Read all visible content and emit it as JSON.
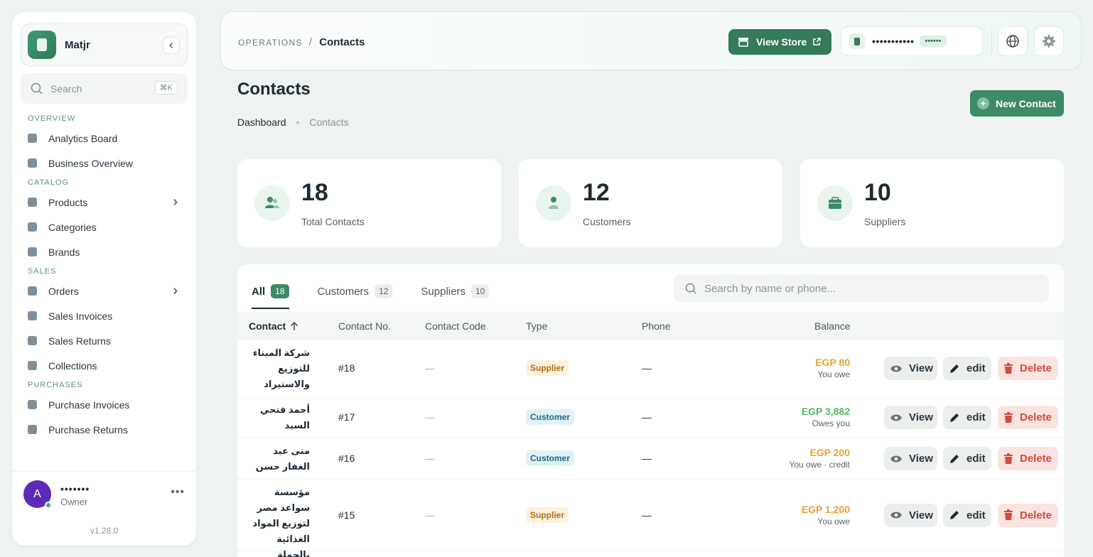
{
  "app": {
    "name": "Matjr",
    "version": "v1.28.0"
  },
  "sidebar": {
    "search": {
      "placeholder": "Search",
      "shortcut": "⌘K"
    },
    "sections": [
      {
        "title": "OVERVIEW",
        "items": [
          {
            "label": "Analytics Board",
            "icon": "chart-icon"
          },
          {
            "label": "Business Overview",
            "icon": "grid-icon"
          }
        ]
      },
      {
        "title": "CATALOG",
        "items": [
          {
            "label": "Products",
            "icon": "box-icon",
            "chevron": true
          },
          {
            "label": "Categories",
            "icon": "shapes-icon"
          },
          {
            "label": "Brands",
            "icon": "tag-icon"
          }
        ]
      },
      {
        "title": "SALES",
        "items": [
          {
            "label": "Orders",
            "icon": "cart-icon",
            "chevron": true
          },
          {
            "label": "Sales Invoices",
            "icon": "invoice-icon"
          },
          {
            "label": "Sales Returns",
            "icon": "return-icon"
          },
          {
            "label": "Collections",
            "icon": "coins-icon"
          }
        ]
      },
      {
        "title": "PURCHASES",
        "items": [
          {
            "label": "Purchase Invoices",
            "icon": "invoice-icon"
          },
          {
            "label": "Purchase Returns",
            "icon": "return-icon"
          }
        ]
      }
    ],
    "user": {
      "initial": "A",
      "name": "•••••••",
      "role": "Owner"
    }
  },
  "topbar": {
    "breadcrumb_parent": "OPERATIONS",
    "breadcrumb_sep": "/",
    "breadcrumb_current": "Contacts",
    "view_store_label": "View Store",
    "store_name": "•••••••••••",
    "store_badge": "••••••"
  },
  "page": {
    "title": "Contacts",
    "breadcrumb": [
      "Dashboard",
      "Contacts"
    ],
    "new_button": "New Contact"
  },
  "stats": [
    {
      "value": "18",
      "label": "Total Contacts",
      "icon": "users-icon"
    },
    {
      "value": "12",
      "label": "Customers",
      "icon": "user-icon"
    },
    {
      "value": "10",
      "label": "Suppliers",
      "icon": "briefcase-icon"
    }
  ],
  "tabs": [
    {
      "label": "All",
      "count": "18",
      "active": true
    },
    {
      "label": "Customers",
      "count": "12"
    },
    {
      "label": "Suppliers",
      "count": "10"
    }
  ],
  "table_search": {
    "placeholder": "Search by name or phone..."
  },
  "columns": [
    "Contact",
    "Contact No.",
    "Contact Code",
    "Type",
    "Phone",
    "Balance"
  ],
  "actions": {
    "view": "View",
    "edit": "edit",
    "delete": "Delete"
  },
  "rows": [
    {
      "name": "شركة الميناء للتوزيع والاستيراد",
      "no": "#18",
      "code": "—",
      "type": "Supplier",
      "phone": "—",
      "amount": "EGP 80",
      "note": "You owe",
      "color": "#e8a134"
    },
    {
      "name": "أحمد فتحي السيد",
      "no": "#17",
      "code": "—",
      "type": "Customer",
      "phone": "—",
      "amount": "EGP 3,882",
      "note": "Owes you",
      "color": "#4db85d"
    },
    {
      "name": "منى عبد الغفار حسن",
      "no": "#16",
      "code": "—",
      "type": "Customer",
      "phone": "—",
      "amount": "EGP 200",
      "note": "You owe · credit",
      "color": "#e8a134"
    },
    {
      "name": "مؤسسة سواعد مصر لتوزيع المواد الغذائية بالجملة",
      "no": "#15",
      "code": "—",
      "type": "Supplier",
      "phone": "—",
      "amount": "EGP 1,200",
      "note": "You owe",
      "color": "#e8a134"
    }
  ]
}
